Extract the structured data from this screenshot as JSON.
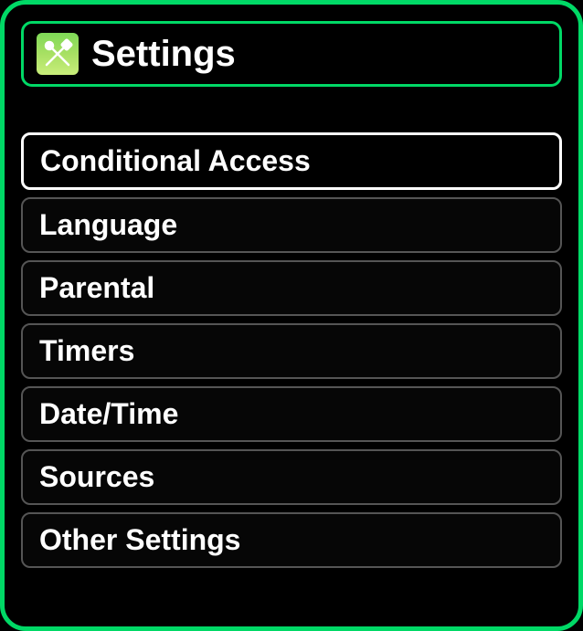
{
  "header": {
    "title": "Settings",
    "icon": "settings-tools-icon"
  },
  "menu": {
    "items": [
      {
        "label": "Conditional Access",
        "selected": true
      },
      {
        "label": "Language",
        "selected": false
      },
      {
        "label": "Parental",
        "selected": false
      },
      {
        "label": "Timers",
        "selected": false
      },
      {
        "label": "Date/Time",
        "selected": false
      },
      {
        "label": "Sources",
        "selected": false
      },
      {
        "label": "Other Settings",
        "selected": false
      }
    ]
  }
}
